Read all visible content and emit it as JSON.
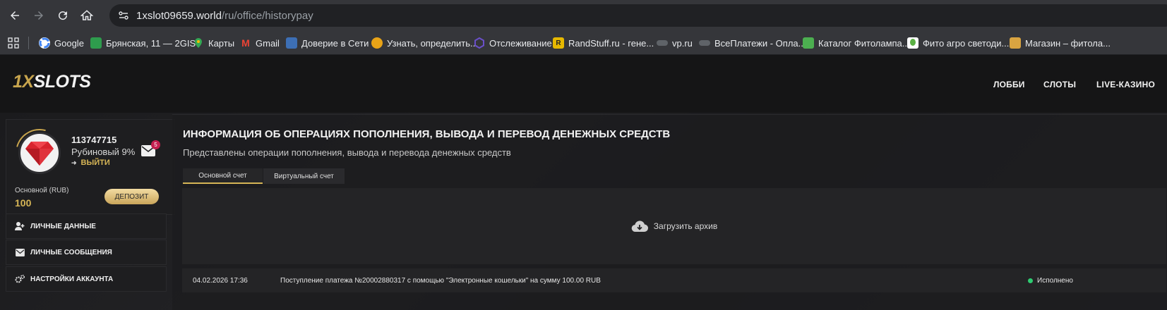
{
  "browser": {
    "url_host": "1xslot09659.world",
    "url_path": "/ru/office/historypay"
  },
  "bookmarks": [
    {
      "label": "Google",
      "icon": "google-icon",
      "color": "#ffffff"
    },
    {
      "label": "Брянская, 11 — 2GIS",
      "icon": "2gis-icon",
      "color": "#2e9c4d"
    },
    {
      "label": "Карты",
      "icon": "maps-pin-icon",
      "color": "#34a853"
    },
    {
      "label": "Gmail",
      "icon": "gmail-icon",
      "color": "#ea4335"
    },
    {
      "label": "Доверие в Сети",
      "icon": "trust-icon",
      "color": "#3d6fb5"
    },
    {
      "label": "Узнать, определить...",
      "icon": "find-icon",
      "color": "#e8a317"
    },
    {
      "label": "Отслеживание",
      "icon": "tracking-icon",
      "color": "#6a4fc9"
    },
    {
      "label": "RandStuff.ru - гене...",
      "icon": "randstuff-icon",
      "color": "#e6b800"
    },
    {
      "label": "vp.ru",
      "icon": "toggle-icon",
      "color": "#5f6368"
    },
    {
      "label": "ВсеПлатежи - Опла...",
      "icon": "toggle-icon",
      "color": "#5f6368"
    },
    {
      "label": "Каталог Фитолампа...",
      "icon": "catalog-icon",
      "color": "#4caf50"
    },
    {
      "label": "Фито агро светоди...",
      "icon": "plant-icon",
      "color": "#5ab043"
    },
    {
      "label": "Магазин – фитола...",
      "icon": "shop-icon",
      "color": "#d9a441"
    }
  ],
  "site": {
    "logo_prefix": "1X",
    "logo_suffix": "SLOTS",
    "nav": [
      "ЛОББИ",
      "СЛОТЫ",
      "LIVE-КАЗИНО"
    ]
  },
  "profile": {
    "user_id": "113747715",
    "level": "Рубиновый 9%",
    "logout_label": "ВЫЙТИ",
    "mail_count": "5",
    "account_label": "Основной (RUB)",
    "account_value": "100",
    "deposit_label": "ДЕПОЗИТ"
  },
  "menu": [
    {
      "label": "ЛИЧНЫЕ ДАННЫЕ",
      "icon": "user-plus-icon"
    },
    {
      "label": "ЛИЧНЫЕ СООБЩЕНИЯ",
      "icon": "envelope-icon"
    },
    {
      "label": "НАСТРОЙКИ АККАУНТА",
      "icon": "gears-icon"
    }
  ],
  "main": {
    "title": "ИНФОРМАЦИЯ ОБ ОПЕРАЦИЯХ ПОПОЛНЕНИЯ, ВЫВОДА И ПЕРЕВОД ДЕНЕЖНЫХ СРЕДСТВ",
    "subtitle": "Представлены операции пополнения, вывода и перевода денежных средств",
    "tabs": [
      {
        "label": "Основной счет",
        "active": true
      },
      {
        "label": "Виртуальный счет",
        "active": false
      }
    ],
    "archive_label": "Загрузить архив",
    "transactions": [
      {
        "datetime": "04.02.2026 17:36",
        "description": "Поступление платежа №20002880317 с помощью \"Электронные кошельки\" на сумму 100.00 RUB",
        "status": "Исполнено",
        "status_color": "#2ecc71"
      }
    ]
  },
  "colors": {
    "accent_gold": "#d6b556",
    "badge_red": "#c4204f"
  }
}
